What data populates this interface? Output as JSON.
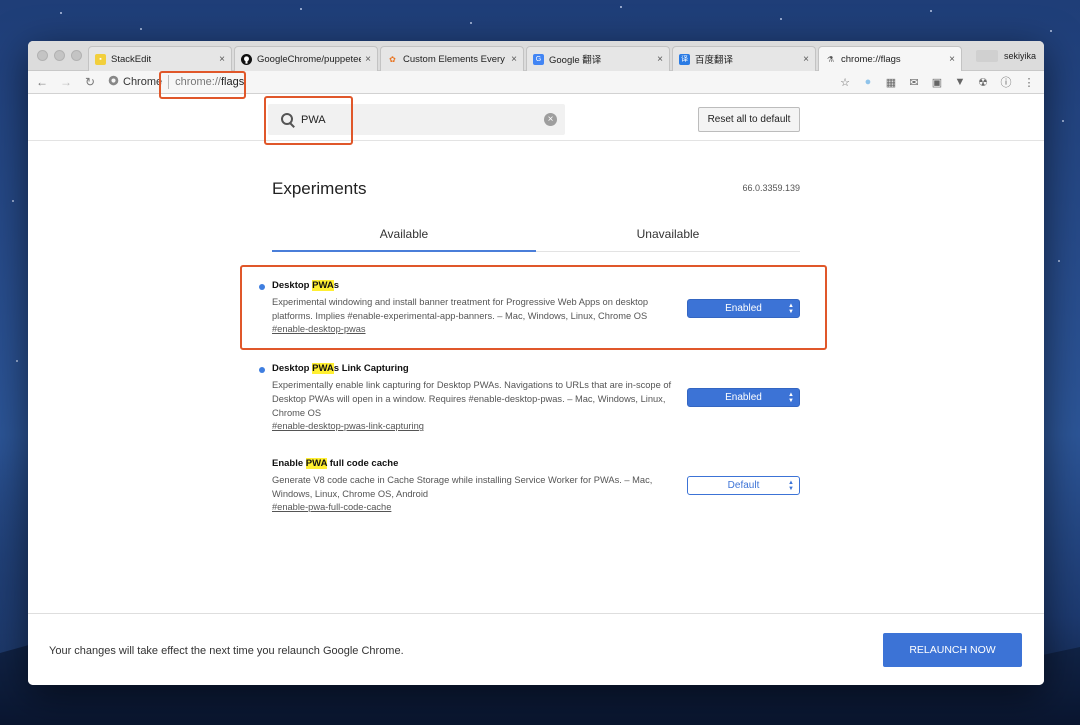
{
  "browser": {
    "tabs": [
      {
        "label": "StackEdit",
        "icon": "stackedit-favicon",
        "active": false
      },
      {
        "label": "GoogleChrome/puppeteer",
        "icon": "github-icon",
        "active": false
      },
      {
        "label": "Custom Elements Every",
        "icon": "webfundamentals-favicon",
        "active": false
      },
      {
        "label": "Google 翻译",
        "icon": "google-translate-icon",
        "active": false
      },
      {
        "label": "百度翻译",
        "icon": "baidu-translate-icon",
        "active": false
      },
      {
        "label": "chrome://flags",
        "icon": "flask-icon",
        "active": true
      }
    ],
    "profile_name": "sekiyika",
    "omnibox": {
      "site_label": "Chrome",
      "url_scheme": "chrome://",
      "url_path": "flags"
    }
  },
  "search": {
    "value": "PWA",
    "reset_label": "Reset all to default"
  },
  "page": {
    "title": "Experiments",
    "version": "66.0.3359.139",
    "tabs": [
      {
        "label": "Available",
        "active": true
      },
      {
        "label": "Unavailable",
        "active": false
      }
    ]
  },
  "flags": [
    {
      "name_prefix": "Desktop ",
      "name_match": "PWA",
      "name_suffix": "s",
      "description": "Experimental windowing and install banner treatment for Progressive Web Apps on desktop platforms. Implies #enable-experimental-app-banners. – Mac, Windows, Linux, Chrome OS",
      "link": "#enable-desktop-pwas",
      "value": "Enabled",
      "modified": true
    },
    {
      "name_prefix": "Desktop ",
      "name_match": "PWA",
      "name_suffix": "s Link Capturing",
      "description": "Experimentally enable link capturing for Desktop PWAs. Navigations to URLs that are in-scope of Desktop PWAs will open in a window. Requires #enable-desktop-pwas. – Mac, Windows, Linux, Chrome OS",
      "link": "#enable-desktop-pwas-link-capturing",
      "value": "Enabled",
      "modified": true
    },
    {
      "name_prefix": "Enable ",
      "name_match": "PWA",
      "name_suffix": " full code cache",
      "description": "Generate V8 code cache in Cache Storage while installing Service Worker for PWAs. – Mac, Windows, Linux, Chrome OS, Android",
      "link": "#enable-pwa-full-code-cache",
      "value": "Default",
      "modified": false
    }
  ],
  "footer": {
    "message": "Your changes will take effect the next time you relaunch Google Chrome.",
    "relaunch_label": "RELAUNCH NOW"
  },
  "colors": {
    "accent": "#3c73d6",
    "highlight_box": "#e0572a",
    "search_match": "#ffef31"
  }
}
